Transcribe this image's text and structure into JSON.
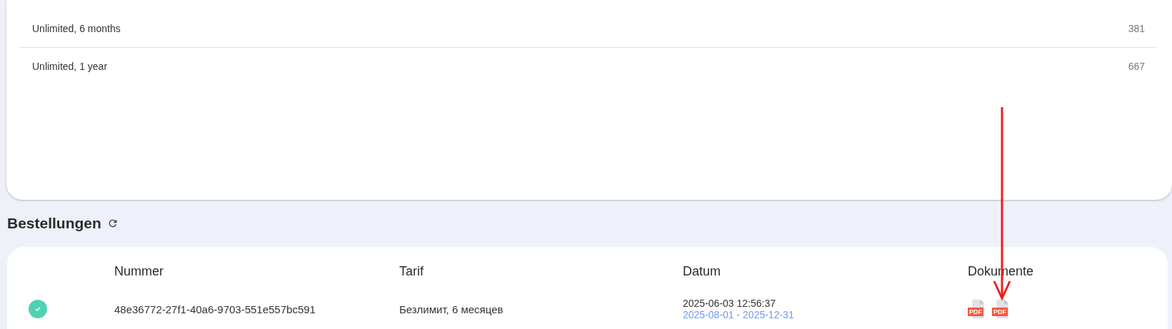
{
  "tariffs": [
    {
      "name": "Unlimited, 6 months",
      "count": "381"
    },
    {
      "name": "Unlimited, 1 year",
      "count": "667"
    }
  ],
  "orders": {
    "title": "Bestellungen",
    "columns": [
      "Nummer",
      "Tarif",
      "Datum",
      "Dokumente"
    ],
    "rows": [
      {
        "completed": true,
        "number": "48e36772-27f1-40a6-9703-551e557bc591",
        "tariff": "Безлимит, 6 месяцев",
        "date": "2025-06-03 12:56:37",
        "period": "2025-08-01 - 2025-12-31",
        "documents": [
          "PDF",
          "PDF"
        ]
      }
    ]
  },
  "annotation": {
    "kind": "arrow"
  }
}
